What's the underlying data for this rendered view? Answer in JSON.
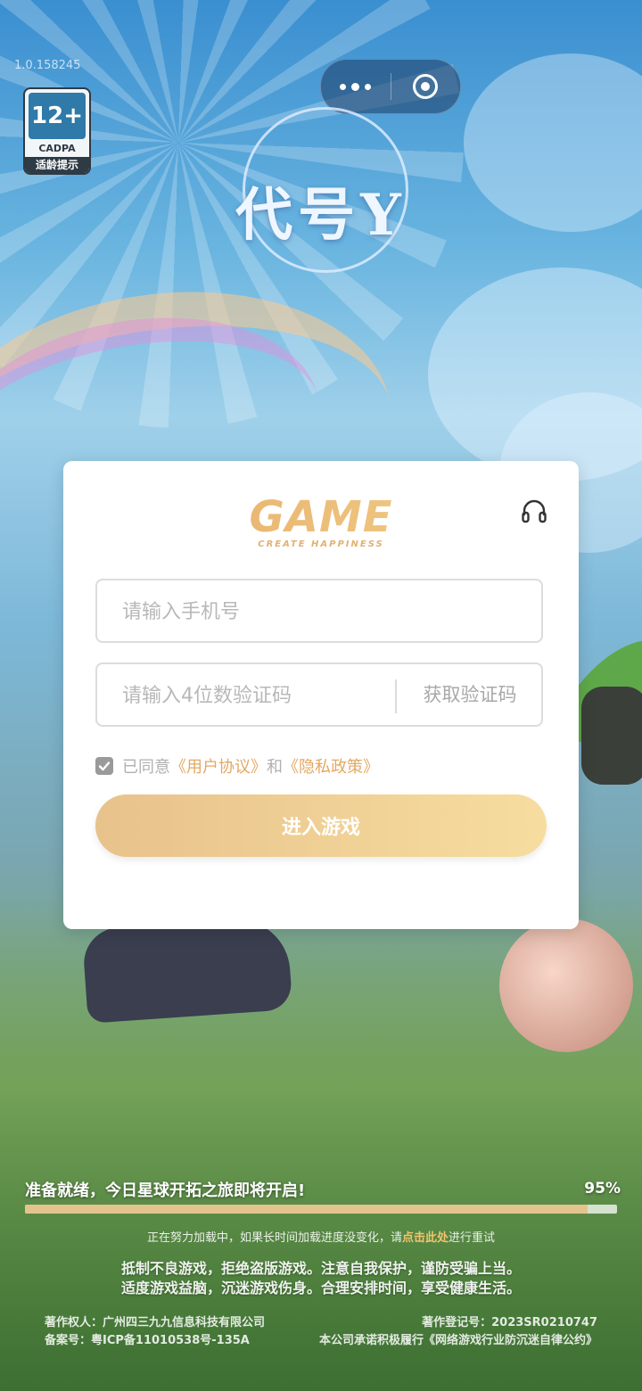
{
  "app": {
    "version": "1.0.158245",
    "logo_text": "代号Y"
  },
  "age_rating": {
    "age": "12+",
    "org": "CADPA",
    "tip": "适龄提示"
  },
  "capsule": {
    "menu_icon": "more-dots-icon",
    "close_icon": "target-close-icon"
  },
  "login": {
    "brand": "GAME",
    "brand_sub": "CREATE HAPPINESS",
    "support_icon": "headset-icon",
    "phone_placeholder": "请输入手机号",
    "code_placeholder": "请输入4位数验证码",
    "get_code_label": "获取验证码",
    "agree_prefix": "已同意",
    "user_agreement": "《用户协议》",
    "and_text": "和",
    "privacy_policy": "《隐私政策》",
    "agreement_checked": true,
    "enter_button": "进入游戏"
  },
  "loading": {
    "message": "准备就绪，今日星球开拓之旅即将开启!",
    "percent_text": "95%",
    "progress": 0.95,
    "retry_prefix": "正在努力加载中，如果长时间加载进度没变化，请",
    "retry_link": "点击此处",
    "retry_suffix": "进行重试"
  },
  "notice": {
    "line1": "抵制不良游戏，拒绝盗版游戏。注意自我保护，谨防受骗上当。",
    "line2": "适度游戏益脑，沉迷游戏伤身。合理安排时间，享受健康生活。"
  },
  "footer": {
    "copyright_owner": "著作权人：广州四三九九信息科技有限公司",
    "registration": "著作登记号：2023SR0210747",
    "icp": "备案号：粤ICP备11010538号-135A",
    "pledge": "本公司承诺积极履行《网络游戏行业防沉迷自律公约》"
  },
  "colors": {
    "accent_gold": "#e3a862",
    "button_start": "#e8c28b",
    "button_end": "#f6dd9f"
  }
}
